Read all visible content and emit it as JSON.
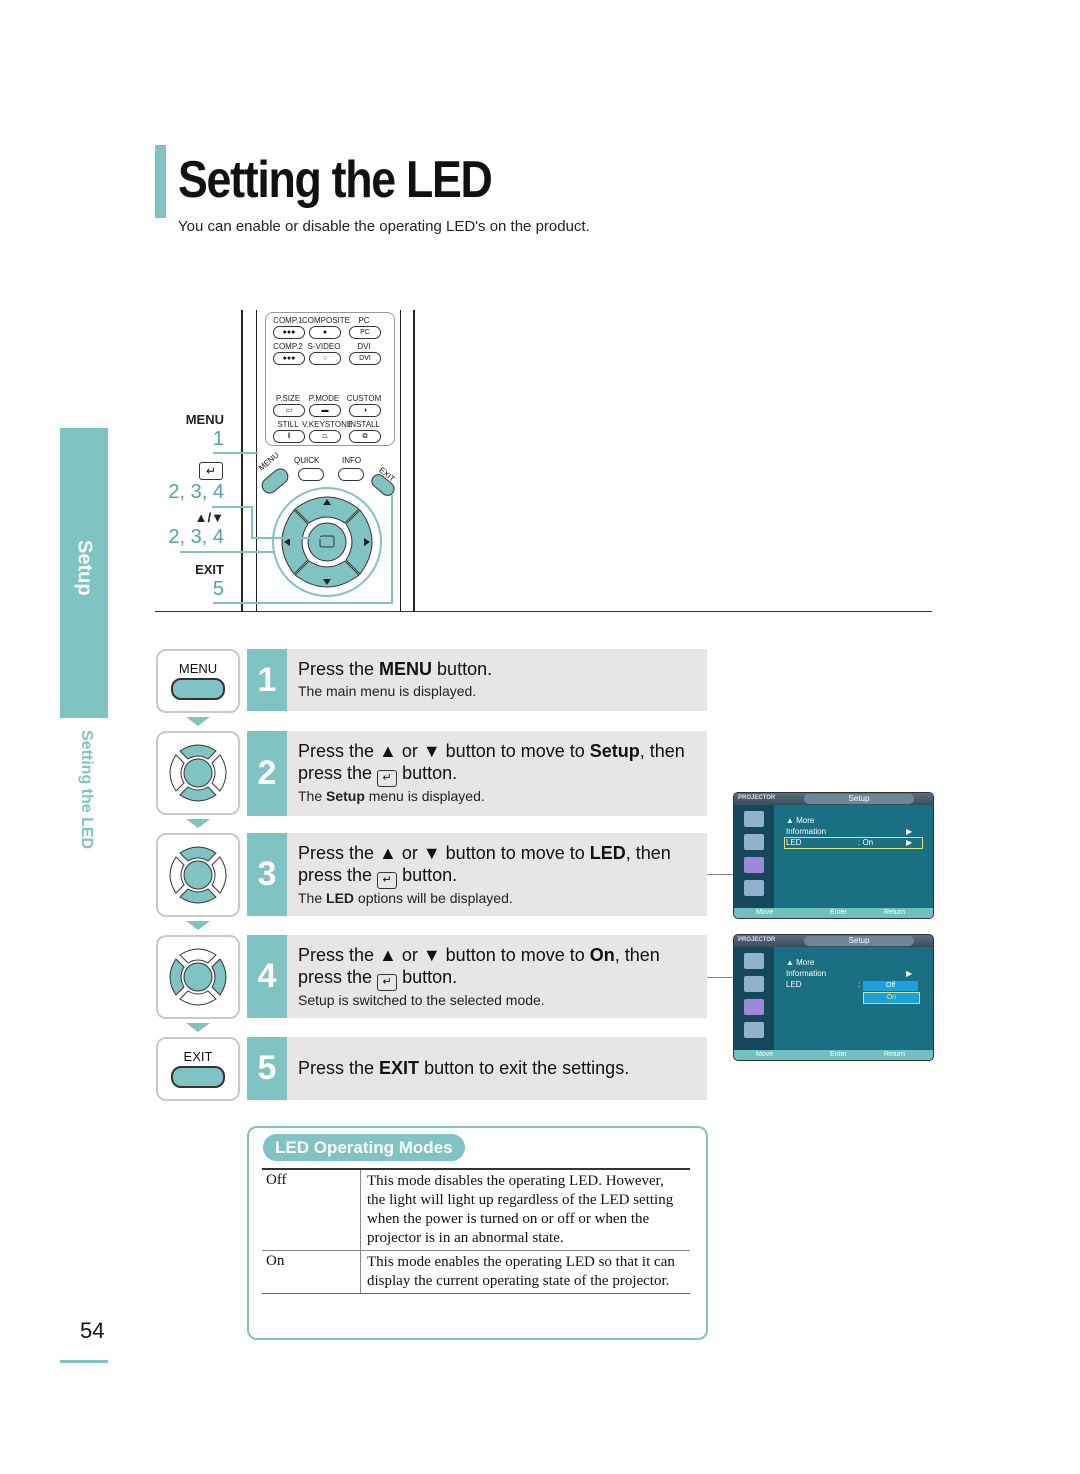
{
  "page": {
    "title": "Setting the LED",
    "subtitle": "You can enable or disable the operating LED's on the product.",
    "page_number": "54",
    "side_tab": "Setup",
    "side_section": "Setting the LED"
  },
  "remote": {
    "buttons": [
      {
        "label": "COMP.1",
        "glyph": "●●●"
      },
      {
        "label": "COMPOSITE",
        "glyph": "●"
      },
      {
        "label": "PC",
        "glyph": "PC"
      },
      {
        "label": "COMP.2",
        "glyph": "●●●"
      },
      {
        "label": "S-VIDEO",
        "glyph": "○"
      },
      {
        "label": "DVI",
        "glyph": "DVI"
      },
      {
        "label": "P.SIZE",
        "glyph": "▭"
      },
      {
        "label": "P.MODE",
        "glyph": "▬"
      },
      {
        "label": "CUSTOM",
        "glyph": "◑"
      },
      {
        "label": "STILL",
        "glyph": "‖"
      },
      {
        "label": "V.KEYSTONE",
        "glyph": "⏢"
      },
      {
        "label": "INSTALL",
        "glyph": "⧉"
      }
    ],
    "menu_label": "MENU",
    "quick_label": "QUICK",
    "info_label": "INFO",
    "exit_label": "EXIT",
    "callouts": [
      {
        "label": "MENU",
        "steps": "1"
      },
      {
        "label": "↵",
        "steps": "2, 3, 4"
      },
      {
        "label": "▲/▼",
        "steps": "2, 3, 4"
      },
      {
        "label": "EXIT",
        "steps": "5"
      }
    ]
  },
  "steps": [
    {
      "num": "1",
      "icon_label": "MENU",
      "main_pre": "Press the ",
      "main_bold": "MENU",
      "main_post": " button.",
      "main_line2": "",
      "sub_pre": "The main menu is displayed.",
      "sub_bold": "",
      "sub_post": ""
    },
    {
      "num": "2",
      "icon_label": "",
      "main_pre": "Press the ▲ or ▼ button to move to ",
      "main_bold": "Setup",
      "main_post": ", then",
      "main_line2": "press the",
      "main_line2_post": "button.",
      "sub_pre": "The ",
      "sub_bold": "Setup",
      "sub_post": " menu is displayed."
    },
    {
      "num": "3",
      "icon_label": "",
      "main_pre": "Press the ▲ or ▼ button to move to ",
      "main_bold": "LED",
      "main_post": ", then",
      "main_line2": "press the",
      "main_line2_post": "button.",
      "sub_pre": "The ",
      "sub_bold": "LED",
      "sub_post": " options will be displayed."
    },
    {
      "num": "4",
      "icon_label": "",
      "main_pre": "Press the ▲ or ▼ button to move to ",
      "main_bold": "On",
      "main_post": ", then",
      "main_line2": "press the",
      "main_line2_post": "button.",
      "sub_pre": "Setup is switched to the selected mode.",
      "sub_bold": "",
      "sub_post": ""
    },
    {
      "num": "5",
      "icon_label": "EXIT",
      "main_pre": "Press the ",
      "main_bold": "EXIT",
      "main_post": " button to exit the settings.",
      "main_line2": "",
      "sub_pre": "",
      "sub_bold": "",
      "sub_post": ""
    }
  ],
  "osd_screens": [
    {
      "brand": "PROJECTOR",
      "title": "Setup",
      "items": [
        {
          "label": "▲ More",
          "value": "",
          "arrow": ""
        },
        {
          "label": "Information",
          "value": "",
          "arrow": "▶"
        },
        {
          "label": "LED",
          "value": ": On",
          "arrow": "▶"
        }
      ],
      "footer": {
        "move": "Move",
        "enter": "Enter",
        "return": "Return"
      }
    },
    {
      "brand": "PROJECTOR",
      "title": "Setup",
      "items": [
        {
          "label": "▲ More",
          "value": "",
          "arrow": ""
        },
        {
          "label": "Information",
          "value": "",
          "arrow": "▶"
        },
        {
          "label": "LED",
          "value": ":",
          "arrow": ""
        }
      ],
      "dropdown": [
        "Off",
        "On"
      ],
      "selected": "On",
      "footer": {
        "move": "Move",
        "enter": "Enter",
        "return": "Return"
      }
    }
  ],
  "modes": {
    "heading": "LED Operating Modes",
    "rows": [
      {
        "mode": "Off",
        "description": "This mode disables the operating LED. However, the light will light up regardless of the LED setting when the power is turned on or off or when the projector is in an abnormal state."
      },
      {
        "mode": "On",
        "description": "This mode enables the operating LED so that it can display the current operating state of the projector."
      }
    ]
  },
  "colors": {
    "accent": "#7fc3c3",
    "step_bg": "#e6e6e6"
  }
}
